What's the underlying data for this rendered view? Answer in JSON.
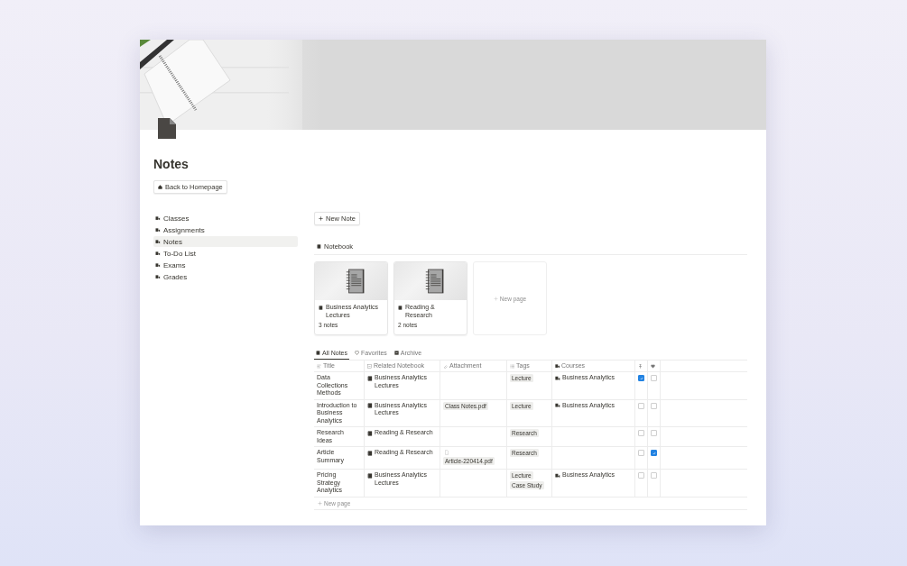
{
  "title": "Notes",
  "back_button": "Back to Homepage",
  "sidebar": {
    "items": [
      {
        "label": "Classes",
        "selected": false
      },
      {
        "label": "Assignments",
        "selected": false
      },
      {
        "label": "Notes",
        "selected": true
      },
      {
        "label": "To-Do List",
        "selected": false
      },
      {
        "label": "Exams",
        "selected": false
      },
      {
        "label": "Grades",
        "selected": false
      }
    ]
  },
  "new_note_button": "New Note",
  "notebook_section": {
    "label": "Notebook",
    "cards": [
      {
        "title": "Business Analytics Lectures",
        "count": "3 notes"
      },
      {
        "title": "Reading & Research",
        "count": "2 notes"
      }
    ],
    "new_page": "New page"
  },
  "view_tabs": [
    {
      "label": "All Notes",
      "selected": true
    },
    {
      "label": "Favorites",
      "selected": false
    },
    {
      "label": "Archive",
      "selected": false
    }
  ],
  "table": {
    "columns": [
      "Title",
      "Related Notebook",
      "Attachment",
      "Tags",
      "Courses"
    ],
    "rows": [
      {
        "title": "Data Collections Methods",
        "notebook": "Business Analytics Lectures",
        "tags": [
          "Lecture"
        ],
        "course": "Business Analytics",
        "pinned": true,
        "favorite": false
      },
      {
        "title": "Introduction to Business Analytics",
        "notebook": "Business Analytics Lectures",
        "attachment": {
          "name": "Class Notes.pdf",
          "kind": "chip"
        },
        "tags": [
          "Lecture"
        ],
        "course": "Business Analytics",
        "pinned": false,
        "favorite": false
      },
      {
        "title": "Research Ideas",
        "notebook": "Reading & Research",
        "tags": [
          "Research"
        ],
        "pinned": false,
        "favorite": false
      },
      {
        "title": "Article Summary",
        "notebook": "Reading & Research",
        "attachment": {
          "name": "Article-220414.pdf",
          "kind": "thumbnail"
        },
        "tags": [
          "Research"
        ],
        "pinned": false,
        "favorite": true
      },
      {
        "title": "Pricing Strategy Analytics",
        "notebook": "Business Analytics Lectures",
        "tags": [
          "Lecture",
          "Case Study"
        ],
        "course": "Business Analytics",
        "pinned": false,
        "favorite": false
      }
    ],
    "new_page": "New page"
  }
}
